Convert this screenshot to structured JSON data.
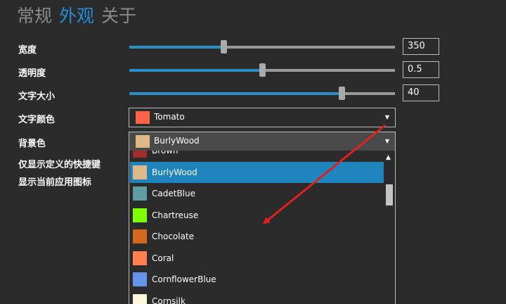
{
  "tabs": [
    {
      "label": "常规",
      "active": false
    },
    {
      "label": "外观",
      "active": true
    },
    {
      "label": "关于",
      "active": false
    }
  ],
  "settings": {
    "width": {
      "label": "宽度",
      "value": "350",
      "fraction": 0.355
    },
    "opacity": {
      "label": "透明度",
      "value": "0.5",
      "fraction": 0.5
    },
    "font_size": {
      "label": "文字大小",
      "value": "40",
      "fraction": 0.8
    },
    "text_color": {
      "label": "文字颜色",
      "selected": "Tomato",
      "color": "#ff6347"
    },
    "bg_color": {
      "label": "背景色",
      "selected": "BurlyWood",
      "color": "#deb887"
    },
    "custom_shortcut": {
      "label": "仅显示定义的快捷键"
    },
    "show_icon": {
      "label": "显示当前应用图标"
    }
  },
  "dropdown": {
    "items": [
      {
        "name": "Brown",
        "color": "#a52a2a",
        "selected": false
      },
      {
        "name": "BurlyWood",
        "color": "#deb887",
        "selected": true
      },
      {
        "name": "CadetBlue",
        "color": "#5f9ea0",
        "selected": false
      },
      {
        "name": "Chartreuse",
        "color": "#7fff00",
        "selected": false
      },
      {
        "name": "Chocolate",
        "color": "#d2691e",
        "selected": false
      },
      {
        "name": "Coral",
        "color": "#ff7f50",
        "selected": false
      },
      {
        "name": "CornflowerBlue",
        "color": "#6495ed",
        "selected": false
      },
      {
        "name": "Cornsilk",
        "color": "#fff8dc",
        "selected": false
      }
    ]
  },
  "colors": {
    "accent": "#1e90d8",
    "annotation_arrow": "#e01f1f"
  }
}
